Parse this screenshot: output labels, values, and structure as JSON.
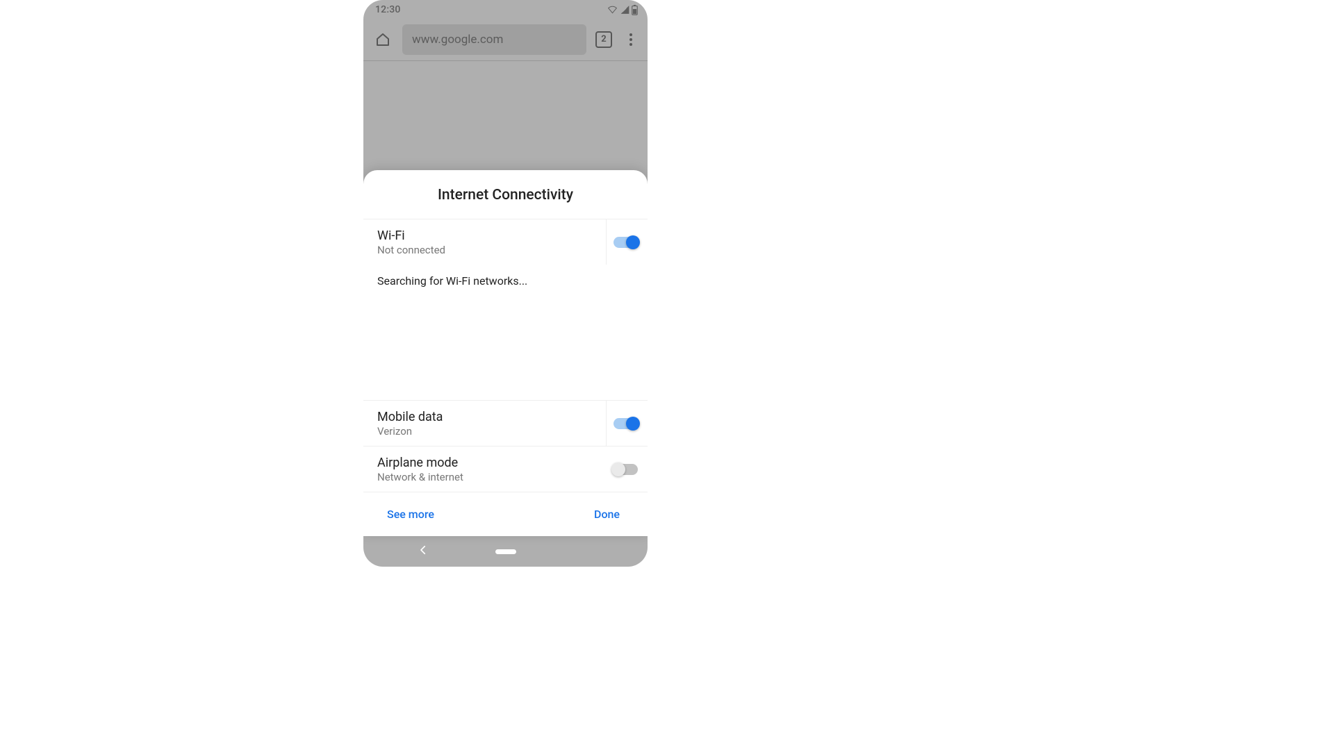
{
  "status_bar": {
    "time": "12:30"
  },
  "browser": {
    "url": "www.google.com",
    "tab_count": "2"
  },
  "sheet": {
    "title": "Internet Connectivity",
    "wifi": {
      "title": "Wi-Fi",
      "subtitle": "Not connected",
      "enabled": true,
      "searching_text": "Searching for Wi-Fi networks..."
    },
    "mobile_data": {
      "title": "Mobile data",
      "subtitle": "Verizon",
      "enabled": true
    },
    "airplane_mode": {
      "title": "Airplane mode",
      "subtitle": "Network & internet",
      "enabled": false
    },
    "footer": {
      "see_more": "See more",
      "done": "Done"
    }
  }
}
